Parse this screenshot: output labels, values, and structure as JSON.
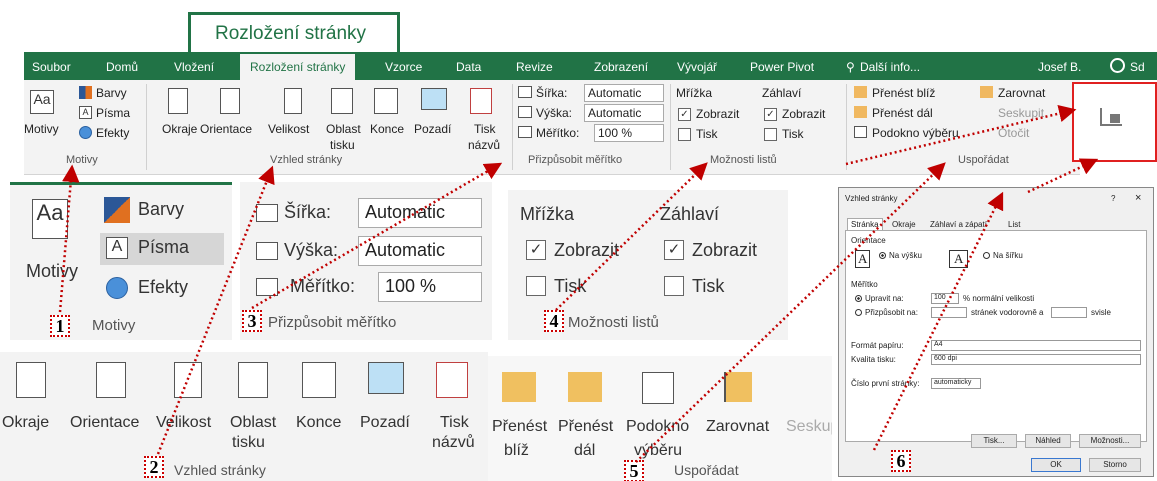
{
  "callout_title": "Rozložení stránky",
  "tabs": [
    "Soubor",
    "Domů",
    "Vložení",
    "Rozložení stránky",
    "Vzorce",
    "Data",
    "Revize",
    "Zobrazení",
    "Vývojář",
    "Power Pivot"
  ],
  "tell_me": "Další info...",
  "user": "Josef B.",
  "share": "Sd",
  "ribbon": {
    "motivy": {
      "label": "Motivy",
      "barvy": "Barvy",
      "pisma": "Písma",
      "efekty": "Efekty",
      "group": "Motivy"
    },
    "vzhled": {
      "okraje": "Okraje",
      "orientace": "Orientace",
      "velikost": "Velikost",
      "oblast1": "Oblast",
      "oblast2": "tisku",
      "konce": "Konce",
      "pozadi": "Pozadí",
      "tisk1": "Tisk",
      "tisk2": "názvů",
      "group": "Vzhled stránky"
    },
    "meritko": {
      "sirka": "Šířka:",
      "vyska": "Výška:",
      "meritko": "Měřítko:",
      "auto": "Automatic",
      "pct": "100 %",
      "group": "Přizpůsobit měřítko"
    },
    "moznosti": {
      "mrizka": "Mřížka",
      "zahlavi": "Záhlaví",
      "zobrazit": "Zobrazit",
      "tisk": "Tisk",
      "group": "Možnosti listů"
    },
    "usporadat": {
      "blize": "Přenést blíž",
      "dale": "Přenést dál",
      "podokno": "Podokno výběru",
      "zarovnat": "Zarovnat",
      "seskupit": "Seskupit",
      "otocit": "Otočit",
      "group": "Uspořádat"
    }
  },
  "zoom_panels": {
    "motivy": {
      "label": "Motivy",
      "barvy": "Barvy",
      "pisma": "Písma",
      "efekty": "Efekty",
      "group": "Motivy"
    },
    "meritko": {
      "sirka": "Šířka:",
      "vyska": "Výška:",
      "meritko": "Měřítko:",
      "auto": "Automatic",
      "pct": "100 %",
      "group": "Přizpůsobit měřítko"
    },
    "moznosti": {
      "mrizka": "Mřížka",
      "zahlavi": "Záhlaví",
      "zobrazit": "Zobrazit",
      "tisk": "Tisk",
      "group": "Možnosti listů"
    },
    "vzhled": {
      "okraje": "Okraje",
      "orientace": "Orientace",
      "velikost": "Velikost",
      "oblast1": "Oblast",
      "oblast2": "tisku",
      "konce": "Konce",
      "pozadi": "Pozadí",
      "tisk1": "Tisk",
      "tisk2": "názvů",
      "group": "Vzhled stránky"
    },
    "usporadat": {
      "prenest1": "Přenést",
      "blize": "blíž",
      "dale": "dál",
      "podokno1": "Podokno",
      "podokno2": "výběru",
      "zarovnat": "Zarovnat",
      "seskup": "Seskup",
      "group": "Uspořádat"
    }
  },
  "numbers": [
    "1",
    "2",
    "3",
    "4",
    "5",
    "6"
  ],
  "dialog": {
    "title": "Vzhled stránky",
    "help": "?",
    "close": "×",
    "tabs": [
      "Stránka",
      "Okraje",
      "Záhlaví a zápatí",
      "List"
    ],
    "orientace": "Orientace",
    "na_vysku": "Na výšku",
    "na_sirku": "Na šířku",
    "meritko": "Měřítko",
    "upravit": "Upravit na:",
    "upravit_val": "100",
    "normalni": "% normální velikosti",
    "prizpusobit": "Přizpůsobit na:",
    "stranek": "stránek vodorovně a",
    "svisle": "svisle",
    "format_label": "Formát papíru:",
    "format_val": "A4",
    "kvalita_label": "Kvalita tisku:",
    "kvalita_val": "600 dpi",
    "cislo_label": "Číslo první stránky:",
    "cislo_val": "automaticky",
    "tisk_btn": "Tisk...",
    "nahled_btn": "Náhled",
    "moznosti_btn": "Možnosti...",
    "ok": "OK",
    "storno": "Storno"
  },
  "colors": {
    "excel_green": "#217346",
    "callout_red": "#c00000",
    "ribbon_bg": "#f3f3f3"
  }
}
